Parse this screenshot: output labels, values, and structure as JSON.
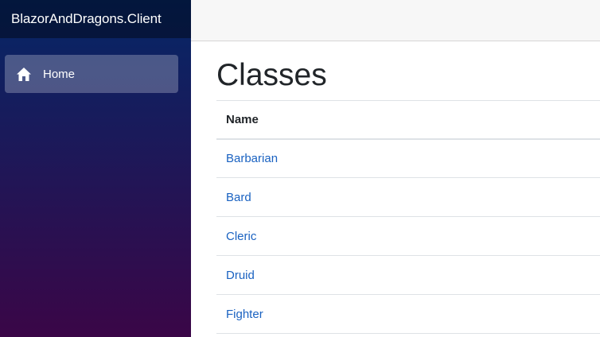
{
  "sidebar": {
    "brand": "BlazorAndDragons.Client",
    "nav": [
      {
        "label": "Home",
        "icon": "home-icon"
      }
    ]
  },
  "page": {
    "title": "Classes",
    "table": {
      "headers": [
        "Name"
      ],
      "rows": [
        "Barbarian",
        "Bard",
        "Cleric",
        "Druid",
        "Fighter"
      ]
    }
  },
  "colors": {
    "sidebar_top": "#052767",
    "sidebar_bottom": "#3a0647",
    "link": "#1a62c1",
    "topbar": "#f7f7f7"
  }
}
